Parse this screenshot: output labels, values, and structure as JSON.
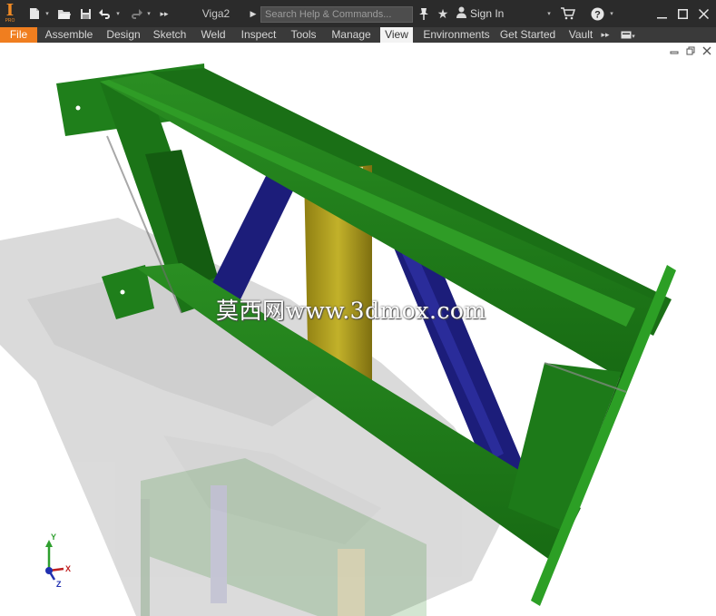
{
  "titlebar": {
    "app_logo_glyph": "I",
    "app_logo_sub": "PRO",
    "document_title": "Viga2",
    "search_placeholder": "Search Help & Commands...",
    "sign_in_label": "Sign In"
  },
  "tabs": [
    {
      "label": "File"
    },
    {
      "label": "Assemble"
    },
    {
      "label": "Design"
    },
    {
      "label": "Sketch"
    },
    {
      "label": "Weld"
    },
    {
      "label": "Inspect"
    },
    {
      "label": "Tools"
    },
    {
      "label": "Manage"
    },
    {
      "label": "View"
    },
    {
      "label": "Environments"
    },
    {
      "label": "Get Started"
    },
    {
      "label": "Vault"
    }
  ],
  "active_tab": "View",
  "watermark_text": "莫西网www.3dmox.com",
  "triad": {
    "y_label": "Y",
    "x_label": "X",
    "z_label": "Z"
  },
  "colors": {
    "titlebar_bg": "#2b2b2b",
    "tabbar_bg": "#3a3a3a",
    "file_tab": "#f07e1f",
    "frame_green": "#1f7a1a",
    "brace_blue": "#1c1d7a",
    "post_yellow": "#b3a320"
  },
  "icons": [
    "new-file-icon",
    "open-icon",
    "save-icon",
    "undo-icon",
    "redo-icon",
    "expand-icon",
    "pin-icon",
    "star-icon",
    "person-icon",
    "cart-icon",
    "help-icon",
    "minimize-icon",
    "maximize-icon",
    "close-icon"
  ]
}
